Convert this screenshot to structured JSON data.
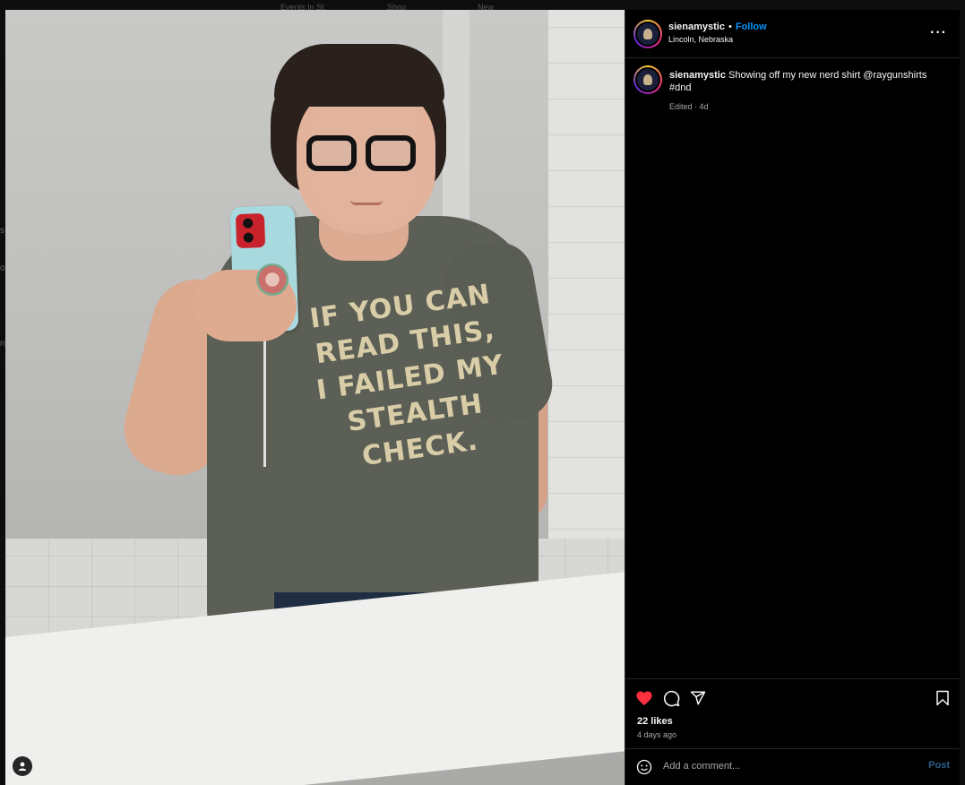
{
  "background_nav": {
    "items": [
      "Events In St.",
      "Shop",
      "New"
    ]
  },
  "background_letters": [
    "s",
    "o",
    "ro"
  ],
  "photo": {
    "shirt_lines": [
      "IF YOU CAN",
      "READ THIS,",
      "I FAILED MY",
      "STEALTH",
      "CHECK."
    ],
    "user_tag_icon": "person-icon"
  },
  "post": {
    "username": "sienamystic",
    "separator": "•",
    "follow_label": "Follow",
    "location": "Lincoln, Nebraska",
    "more_icon": "more-options-icon",
    "more_label": "···",
    "caption_username": "sienamystic",
    "caption_text": " Showing off my new nerd shirt @raygunshirts #dnd",
    "caption_meta": "Edited · 4d",
    "likes": "22 likes",
    "time_ago": "4 days ago",
    "liked": true
  },
  "comment": {
    "placeholder": "Add a comment...",
    "post_label": "Post"
  },
  "colors": {
    "accent": "#0095f6",
    "like": "#ff3040",
    "post_disabled": "#2d5f8a"
  }
}
